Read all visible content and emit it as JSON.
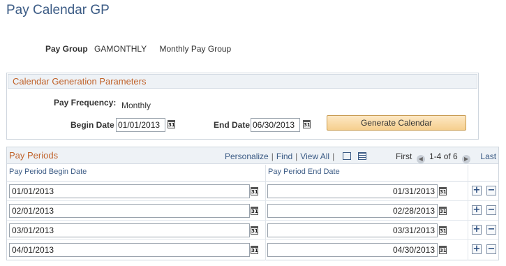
{
  "page": {
    "title": "Pay Calendar GP"
  },
  "paygroup": {
    "label": "Pay Group",
    "code": "GAMONTHLY",
    "description": "Monthly Pay Group"
  },
  "generation": {
    "header": "Calendar Generation Parameters",
    "frequency_label": "Pay Frequency:",
    "frequency_value": "Monthly",
    "begin_label": "Begin Date",
    "begin_value": "01/01/2013",
    "end_label": "End Date",
    "end_value": "06/30/2013",
    "generate_label": "Generate Calendar",
    "calendar_icon_text": "31"
  },
  "grid": {
    "title": "Pay Periods",
    "tools": {
      "personalize": "Personalize",
      "find": "Find",
      "view_all": "View All"
    },
    "nav": {
      "first": "First",
      "count": "1-4 of 6",
      "last": "Last",
      "prev_glyph": "◀",
      "next_glyph": "▶"
    },
    "columns": {
      "begin": "Pay Period Begin Date",
      "end": "Pay Period End Date"
    },
    "add_glyph": "+",
    "remove_glyph": "−",
    "rows": [
      {
        "begin": "01/01/2013",
        "end": "01/31/2013"
      },
      {
        "begin": "02/01/2013",
        "end": "02/28/2013"
      },
      {
        "begin": "03/01/2013",
        "end": "03/31/2013"
      },
      {
        "begin": "04/01/2013",
        "end": "04/30/2013"
      }
    ]
  }
}
